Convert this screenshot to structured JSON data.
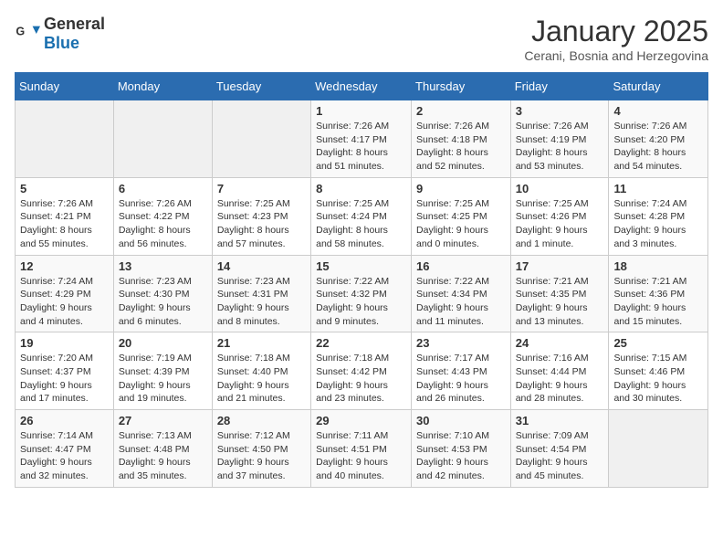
{
  "header": {
    "logo_general": "General",
    "logo_blue": "Blue",
    "month_title": "January 2025",
    "subtitle": "Cerani, Bosnia and Herzegovina"
  },
  "weekdays": [
    "Sunday",
    "Monday",
    "Tuesday",
    "Wednesday",
    "Thursday",
    "Friday",
    "Saturday"
  ],
  "weeks": [
    [
      {
        "day": "",
        "info": ""
      },
      {
        "day": "",
        "info": ""
      },
      {
        "day": "",
        "info": ""
      },
      {
        "day": "1",
        "info": "Sunrise: 7:26 AM\nSunset: 4:17 PM\nDaylight: 8 hours and 51 minutes."
      },
      {
        "day": "2",
        "info": "Sunrise: 7:26 AM\nSunset: 4:18 PM\nDaylight: 8 hours and 52 minutes."
      },
      {
        "day": "3",
        "info": "Sunrise: 7:26 AM\nSunset: 4:19 PM\nDaylight: 8 hours and 53 minutes."
      },
      {
        "day": "4",
        "info": "Sunrise: 7:26 AM\nSunset: 4:20 PM\nDaylight: 8 hours and 54 minutes."
      }
    ],
    [
      {
        "day": "5",
        "info": "Sunrise: 7:26 AM\nSunset: 4:21 PM\nDaylight: 8 hours and 55 minutes."
      },
      {
        "day": "6",
        "info": "Sunrise: 7:26 AM\nSunset: 4:22 PM\nDaylight: 8 hours and 56 minutes."
      },
      {
        "day": "7",
        "info": "Sunrise: 7:25 AM\nSunset: 4:23 PM\nDaylight: 8 hours and 57 minutes."
      },
      {
        "day": "8",
        "info": "Sunrise: 7:25 AM\nSunset: 4:24 PM\nDaylight: 8 hours and 58 minutes."
      },
      {
        "day": "9",
        "info": "Sunrise: 7:25 AM\nSunset: 4:25 PM\nDaylight: 9 hours and 0 minutes."
      },
      {
        "day": "10",
        "info": "Sunrise: 7:25 AM\nSunset: 4:26 PM\nDaylight: 9 hours and 1 minute."
      },
      {
        "day": "11",
        "info": "Sunrise: 7:24 AM\nSunset: 4:28 PM\nDaylight: 9 hours and 3 minutes."
      }
    ],
    [
      {
        "day": "12",
        "info": "Sunrise: 7:24 AM\nSunset: 4:29 PM\nDaylight: 9 hours and 4 minutes."
      },
      {
        "day": "13",
        "info": "Sunrise: 7:23 AM\nSunset: 4:30 PM\nDaylight: 9 hours and 6 minutes."
      },
      {
        "day": "14",
        "info": "Sunrise: 7:23 AM\nSunset: 4:31 PM\nDaylight: 9 hours and 8 minutes."
      },
      {
        "day": "15",
        "info": "Sunrise: 7:22 AM\nSunset: 4:32 PM\nDaylight: 9 hours and 9 minutes."
      },
      {
        "day": "16",
        "info": "Sunrise: 7:22 AM\nSunset: 4:34 PM\nDaylight: 9 hours and 11 minutes."
      },
      {
        "day": "17",
        "info": "Sunrise: 7:21 AM\nSunset: 4:35 PM\nDaylight: 9 hours and 13 minutes."
      },
      {
        "day": "18",
        "info": "Sunrise: 7:21 AM\nSunset: 4:36 PM\nDaylight: 9 hours and 15 minutes."
      }
    ],
    [
      {
        "day": "19",
        "info": "Sunrise: 7:20 AM\nSunset: 4:37 PM\nDaylight: 9 hours and 17 minutes."
      },
      {
        "day": "20",
        "info": "Sunrise: 7:19 AM\nSunset: 4:39 PM\nDaylight: 9 hours and 19 minutes."
      },
      {
        "day": "21",
        "info": "Sunrise: 7:18 AM\nSunset: 4:40 PM\nDaylight: 9 hours and 21 minutes."
      },
      {
        "day": "22",
        "info": "Sunrise: 7:18 AM\nSunset: 4:42 PM\nDaylight: 9 hours and 23 minutes."
      },
      {
        "day": "23",
        "info": "Sunrise: 7:17 AM\nSunset: 4:43 PM\nDaylight: 9 hours and 26 minutes."
      },
      {
        "day": "24",
        "info": "Sunrise: 7:16 AM\nSunset: 4:44 PM\nDaylight: 9 hours and 28 minutes."
      },
      {
        "day": "25",
        "info": "Sunrise: 7:15 AM\nSunset: 4:46 PM\nDaylight: 9 hours and 30 minutes."
      }
    ],
    [
      {
        "day": "26",
        "info": "Sunrise: 7:14 AM\nSunset: 4:47 PM\nDaylight: 9 hours and 32 minutes."
      },
      {
        "day": "27",
        "info": "Sunrise: 7:13 AM\nSunset: 4:48 PM\nDaylight: 9 hours and 35 minutes."
      },
      {
        "day": "28",
        "info": "Sunrise: 7:12 AM\nSunset: 4:50 PM\nDaylight: 9 hours and 37 minutes."
      },
      {
        "day": "29",
        "info": "Sunrise: 7:11 AM\nSunset: 4:51 PM\nDaylight: 9 hours and 40 minutes."
      },
      {
        "day": "30",
        "info": "Sunrise: 7:10 AM\nSunset: 4:53 PM\nDaylight: 9 hours and 42 minutes."
      },
      {
        "day": "31",
        "info": "Sunrise: 7:09 AM\nSunset: 4:54 PM\nDaylight: 9 hours and 45 minutes."
      },
      {
        "day": "",
        "info": ""
      }
    ]
  ]
}
